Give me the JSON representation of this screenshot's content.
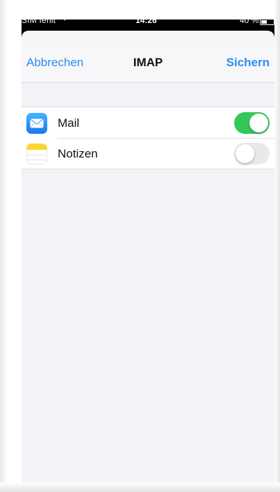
{
  "status_bar": {
    "carrier": "SIM fehlt",
    "wifi_icon": "wifi-icon",
    "time": "14:26",
    "battery": "40 %",
    "battery_level": 0.4
  },
  "nav": {
    "cancel_label": "Abbrechen",
    "title": "IMAP",
    "save_label": "Sichern"
  },
  "colors": {
    "accent": "#2d8cf0",
    "toggle_on": "#34c759",
    "toggle_off": "#e9e9ea",
    "background": "#f2f2f7"
  },
  "accounts_list": {
    "items": [
      {
        "label": "Mail",
        "icon": "mail-app-icon",
        "enabled": true
      },
      {
        "label": "Notizen",
        "icon": "notes-app-icon",
        "enabled": false
      }
    ]
  }
}
